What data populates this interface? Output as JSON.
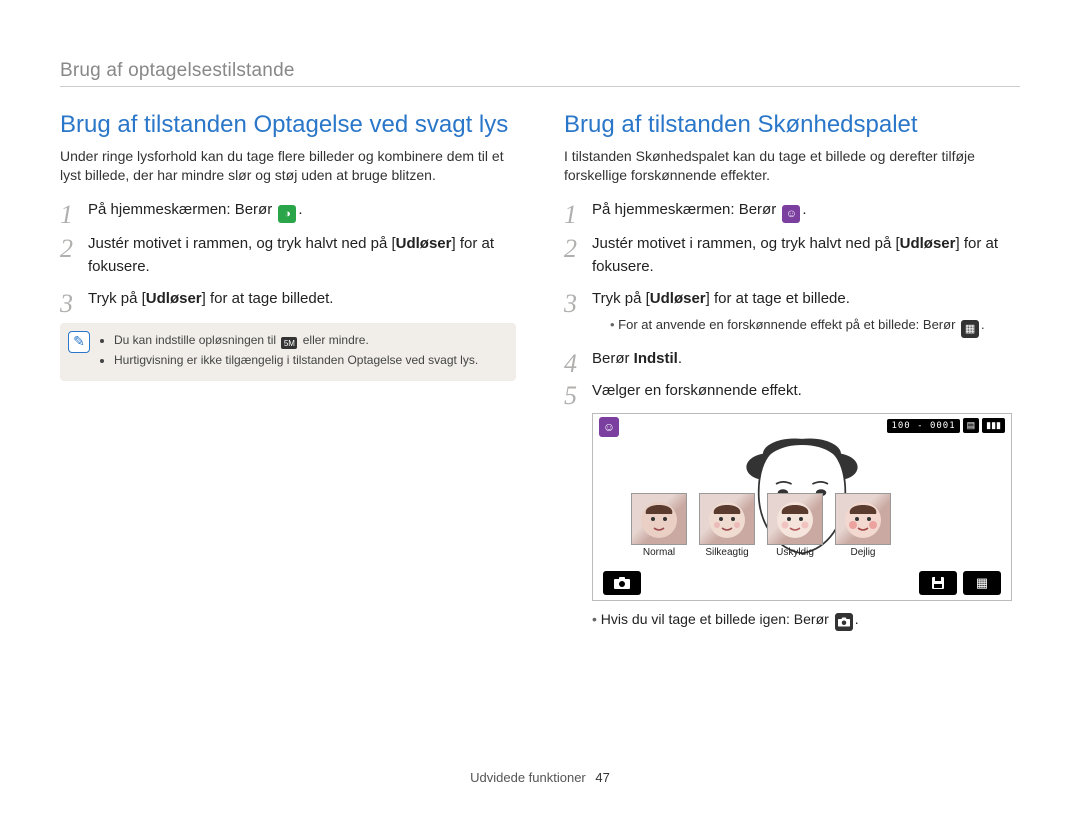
{
  "breadcrumb": "Brug af optagelsestilstande",
  "left": {
    "heading": "Brug af tilstanden Optagelse ved svagt lys",
    "intro": "Under ringe lysforhold kan du tage flere billeder og kombinere dem til et lyst billede, der har mindre slør og støj uden at bruge blitzen.",
    "step1_a": "På hjemmeskærmen: Berør ",
    "step1_b": ".",
    "step2_a": "Justér motivet i rammen, og tryk halvt ned på [",
    "step2_bold": "Udløser",
    "step2_b": "] for at fokusere.",
    "step3_a": "Tryk på [",
    "step3_bold": "Udløser",
    "step3_b": "] for at tage billedet.",
    "note1_a": "Du kan indstille opløsningen til ",
    "note1_b": " eller mindre.",
    "note2": "Hurtigvisning er ikke tilgængelig i tilstanden Optagelse ved svagt lys.",
    "note_res_label": "5M"
  },
  "right": {
    "heading": "Brug af tilstanden Skønhedspalet",
    "intro": "I tilstanden Skønhedspalet kan du tage et billede og derefter tilføje forskellige forskønnende effekter.",
    "step1_a": "På hjemmeskærmen: Berør ",
    "step1_b": ".",
    "step2_a": "Justér motivet i rammen, og tryk halvt ned på [",
    "step2_bold": "Udløser",
    "step2_b": "] for at fokusere.",
    "step3_a": "Tryk på [",
    "step3_bold": "Udløser",
    "step3_b": "] for at tage et billede.",
    "step3_sub_a": "For at anvende en forskønnende effekt på et billede: Berør ",
    "step3_sub_b": ".",
    "step4_a": "Berør ",
    "step4_bold": "Indstil",
    "step4_b": ".",
    "step5": "Vælger en forskønnende effekt.",
    "shot": {
      "counter": "100 - 0001",
      "thumbs": [
        "Normal",
        "Silkeagtig",
        "Uskyldig",
        "Dejlig"
      ]
    },
    "under_a": "Hvis du vil tage et billede igen: Berør ",
    "under_b": "."
  },
  "footer_label": "Udvidede funktioner",
  "footer_page": "47"
}
